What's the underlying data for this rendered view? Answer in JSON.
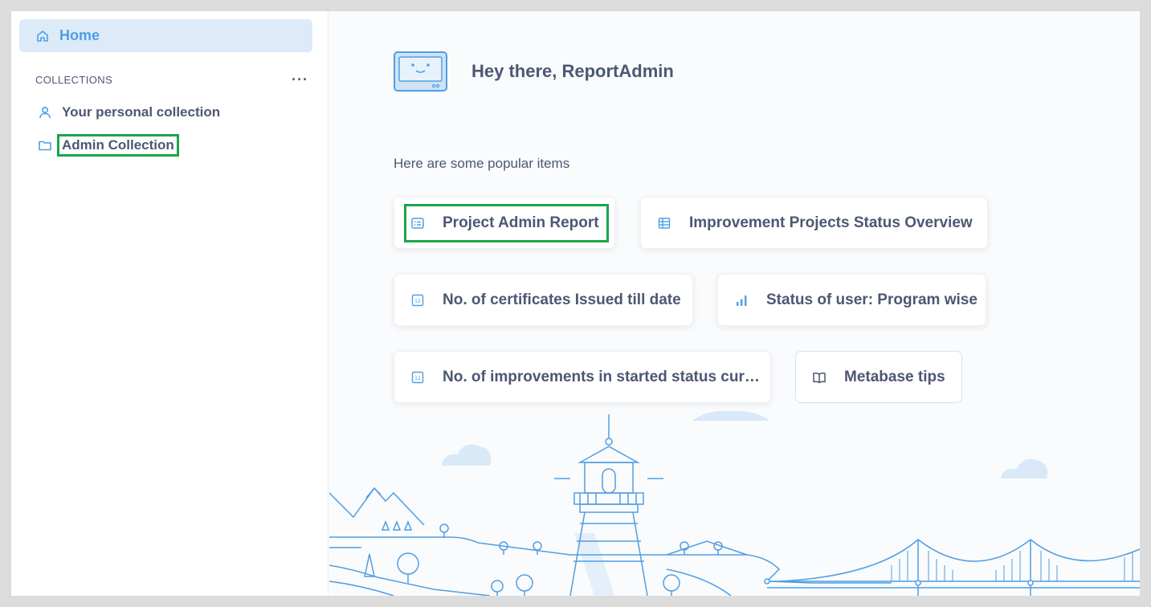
{
  "sidebar": {
    "home_label": "Home",
    "collections_title": "COLLECTIONS",
    "more_label": "···",
    "items": [
      {
        "label": "Your personal collection",
        "icon": "person-icon"
      },
      {
        "label": "Admin Collection",
        "icon": "folder-icon"
      }
    ]
  },
  "main": {
    "greeting": "Hey there, ReportAdmin",
    "popular_title": "Here are some popular items",
    "cards": [
      {
        "label": "Project Admin Report",
        "icon": "dashboard-icon"
      },
      {
        "label": "Improvement Projects Status Overview",
        "icon": "table-icon"
      },
      {
        "label": "No. of certificates Issued till date",
        "icon": "number-icon"
      },
      {
        "label": "Status of user: Program wise",
        "icon": "bar-chart-icon"
      },
      {
        "label": "No. of improvements in started status cur…",
        "icon": "number-icon"
      },
      {
        "label": "Metabase tips",
        "icon": "book-icon"
      }
    ]
  },
  "colors": {
    "accent": "#509ee3",
    "text": "#4c5773",
    "highlight": "#1aa64a",
    "illustration": "#509ee3"
  }
}
